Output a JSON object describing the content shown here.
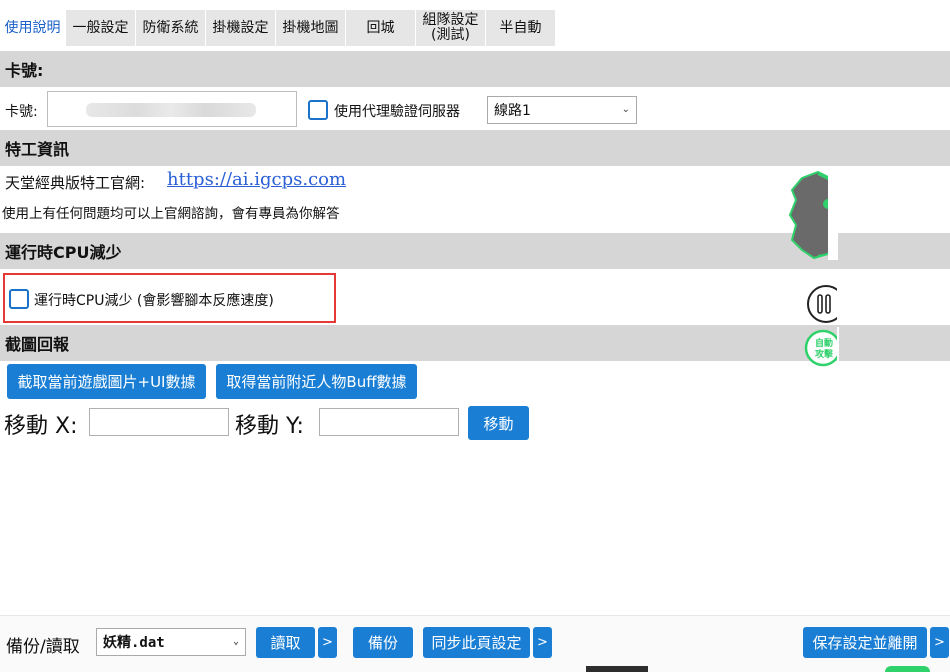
{
  "tabs": [
    {
      "label": "使用說明",
      "active": true
    },
    {
      "label": "一般設定"
    },
    {
      "label": "防衛系統"
    },
    {
      "label": "掛機設定"
    },
    {
      "label": "掛機地圖"
    },
    {
      "label": "回城"
    },
    {
      "label_line1": "組隊設定",
      "label_line2": "(測試)"
    },
    {
      "label": "半自動"
    }
  ],
  "card_section": {
    "header": "卡號:",
    "card_label": "卡號:",
    "proxy_checkbox_label": "使用代理驗證伺服器",
    "server_select_value": "線路1"
  },
  "agent_section": {
    "header": "特工資訊",
    "site_label": "天堂經典版特工官網:",
    "site_link": "https://ai.igcps.com",
    "help_text": "使用上有任何問題均可以上官網諮詢，會有專員為你解答"
  },
  "cpu_section": {
    "header": "運行時CPU減少",
    "checkbox_label": "運行時CPU減少 (會影響腳本反應速度)"
  },
  "screenshot_section": {
    "header": "截圖回報",
    "capture_button": "截取當前遊戲圖片+UI數據",
    "buff_button": "取得當前附近人物Buff數據",
    "move_x_label": "移動 X:",
    "move_y_label": "移動 Y:",
    "move_button": "移動"
  },
  "floating": {
    "auto_attack_text": "自動攻擊"
  },
  "bottom": {
    "backup_label": "備份/讀取",
    "file_select_value": "妖精.dat",
    "read_button": "讀取",
    "more_button_1": ">",
    "backup_button": "備份",
    "sync_button": "同步此頁設定",
    "more_button_2": ">",
    "save_exit_button": "保存設定並離開",
    "more_button_3": ">"
  },
  "colors": {
    "accent_blue": "#1a7fd4",
    "link_blue": "#2a5fd6",
    "section_gray": "#d6d6d6",
    "highlight_red": "#e53935",
    "floating_green": "#2fd16a"
  }
}
